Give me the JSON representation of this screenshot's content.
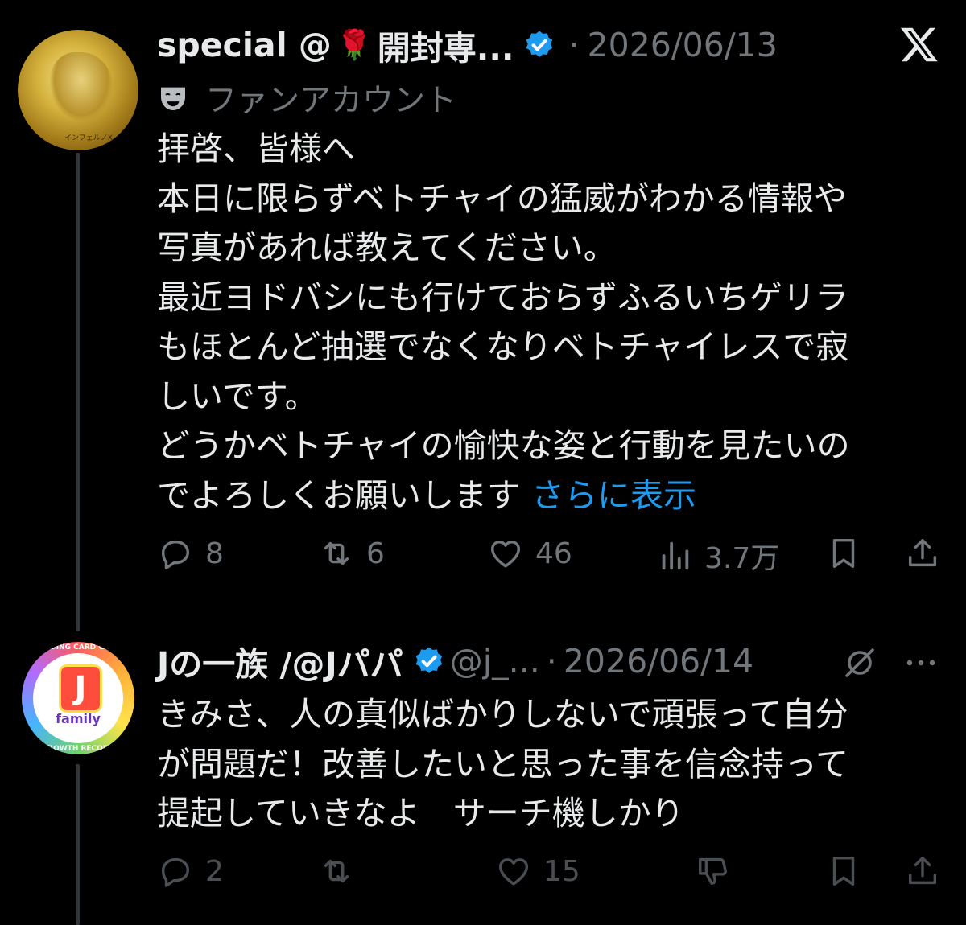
{
  "post1": {
    "author_name": "special @",
    "author_name_rest": "開封専...",
    "separator": "·",
    "date": "2026/06/13",
    "label": "ファンアカウント",
    "avatar_text": "インフェルノX",
    "body_lines": [
      "拝啓、皆様へ",
      "本日に限らずベトチャイの猛威がわかる情報や",
      "写真があれば教えてください。",
      "最近ヨドバシにも行けておらずふるいちゲリラ",
      "もほとんど抽選でなくなりベトチャイレスで寂",
      "しいです。",
      "どうかベトチャイの愉快な姿と行動を見たいの",
      "でよろしくお願いします"
    ],
    "show_more": "さらに表示",
    "replies": "8",
    "reposts": "6",
    "likes": "46",
    "views": "3.7万"
  },
  "post2": {
    "author_name": "Jの一族 /@Jパパ",
    "handle": "@j_...",
    "separator": "·",
    "date": "2026/06/14",
    "avatar": {
      "ring_top": "TRADING CARD GAME",
      "letter": "J",
      "family": "family",
      "ring_bottom": "GROWTH RECORD"
    },
    "body_lines": [
      "きみさ、人の真似ばかりしないで頑張って自分",
      "が問題だ！改善したいと思った事を信念持って",
      "提起していきなよ　サーチ機しかり"
    ],
    "replies": "2",
    "likes": "15"
  },
  "colors": {
    "background": "#000000",
    "text": "#e7e9ea",
    "muted": "#71767b",
    "link": "#1d9bf0",
    "verified": "#1d9bf0"
  },
  "icons": [
    "x-logo-icon",
    "verified-badge-icon",
    "rose-icon",
    "mask-icon",
    "reply-icon",
    "repost-icon",
    "like-icon",
    "views-icon",
    "bookmark-icon",
    "share-icon",
    "remove-repost-icon",
    "more-icon",
    "dislike-icon"
  ]
}
